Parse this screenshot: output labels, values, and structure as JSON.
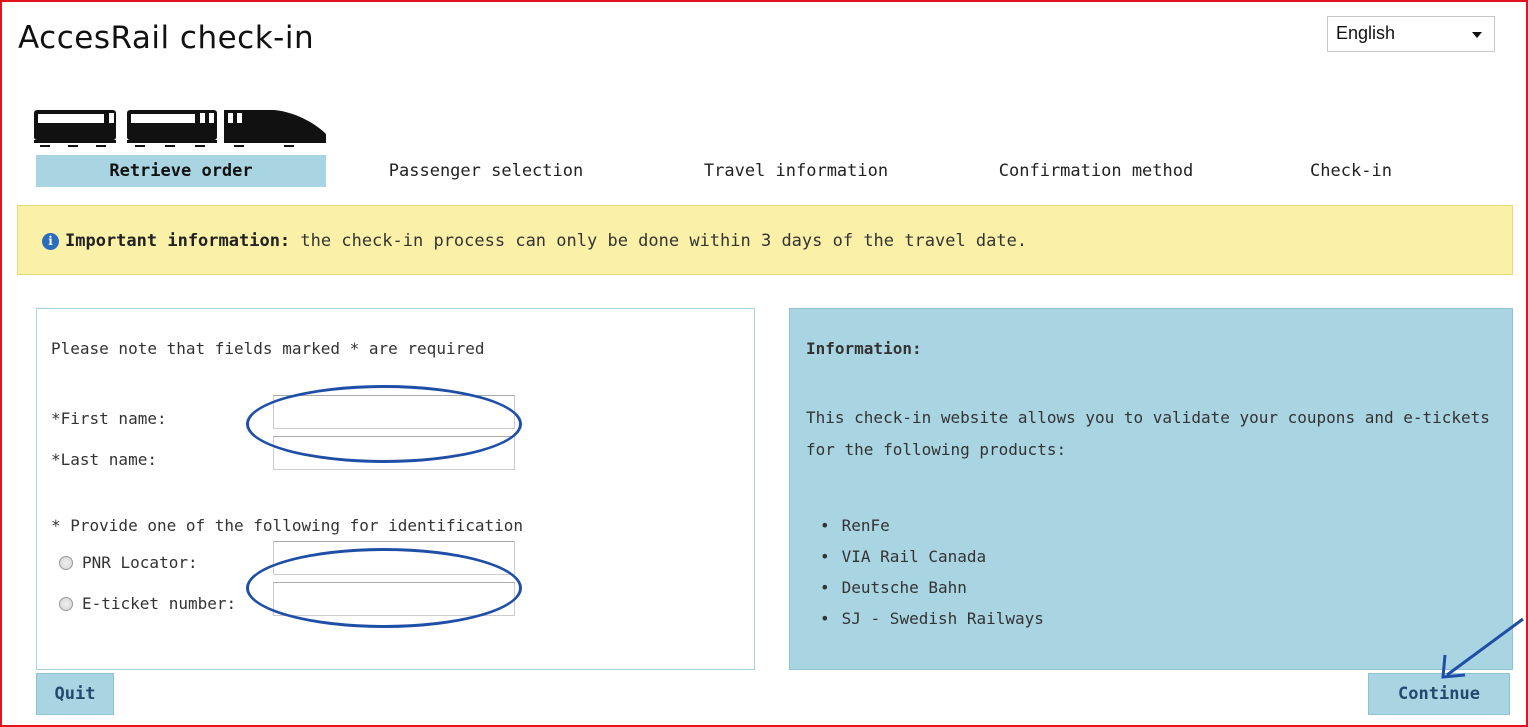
{
  "header": {
    "title": "AccesRail check-in"
  },
  "language": {
    "selected": "English"
  },
  "steps": [
    {
      "label": "Retrieve order",
      "active": true
    },
    {
      "label": "Passenger selection",
      "active": false
    },
    {
      "label": "Travel information",
      "active": false
    },
    {
      "label": "Confirmation method",
      "active": false
    },
    {
      "label": "Check-in",
      "active": false
    }
  ],
  "notice": {
    "bold": "Important information:",
    "text": " the check-in process can only be done within 3 days of the travel date."
  },
  "form": {
    "required_note": "Please note that fields marked * are required",
    "first_name_label": "*First name:",
    "first_name_value": "",
    "last_name_label": "*Last name:",
    "last_name_value": "",
    "identification_note": "* Provide one of the following for identification",
    "pnr_label": "PNR Locator:",
    "pnr_value": "",
    "eticket_label": "E-ticket number:",
    "eticket_value": ""
  },
  "info": {
    "title": "Information:",
    "body": "This check-in website allows you to validate your coupons and e-tickets for the following products:",
    "products": [
      "RenFe",
      "VIA Rail Canada",
      "Deutsche Bahn",
      "SJ - Swedish Railways"
    ]
  },
  "buttons": {
    "quit": "Quit",
    "continue": "Continue"
  },
  "colors": {
    "accent": "#a9d5e3",
    "notice_bg": "#fbf0a8",
    "annotation": "#1f4ea6",
    "frame": "#e1141d"
  }
}
